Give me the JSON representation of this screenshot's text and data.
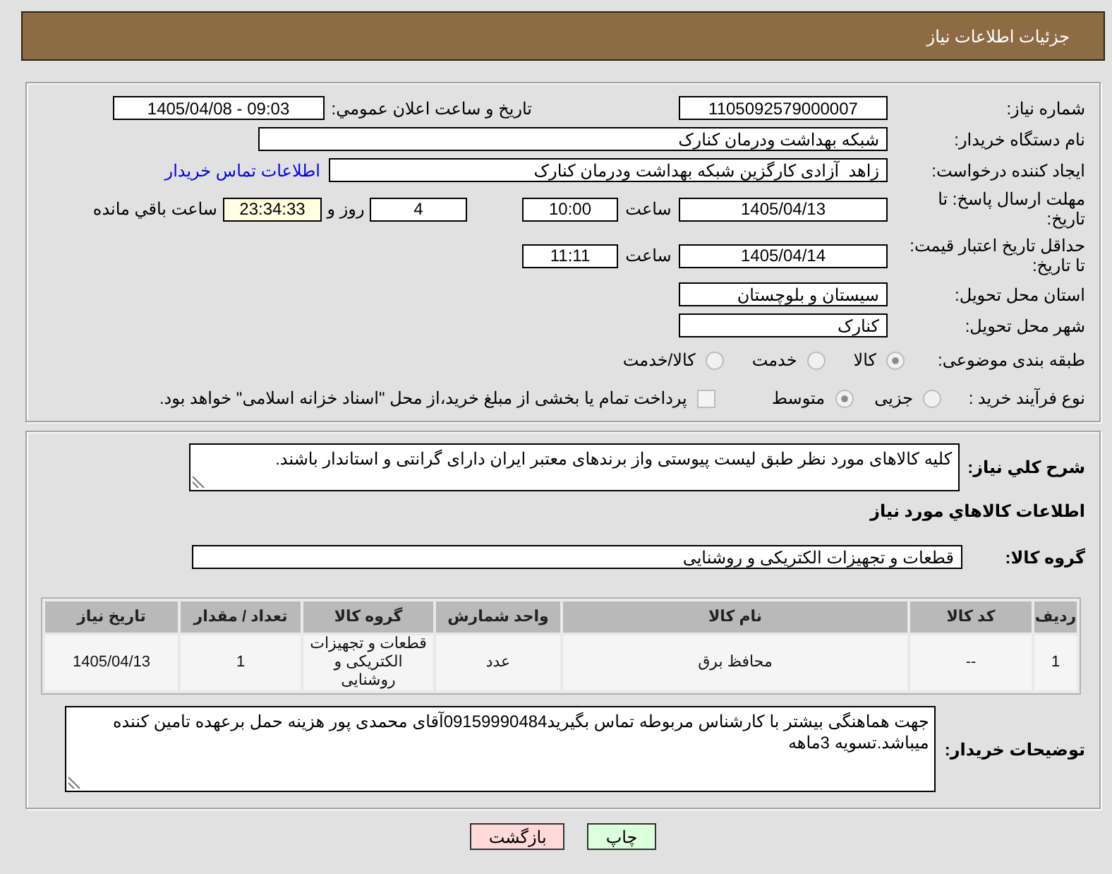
{
  "header": {
    "title": "جزئیات اطلاعات نیاز"
  },
  "details": {
    "need_number": {
      "label": "شماره نیاز:",
      "value": "1105092579000007"
    },
    "announcement": {
      "label": "تاریخ و ساعت اعلان عمومي:",
      "value": "1405/04/08 - 09:03"
    },
    "buyer_org": {
      "label": "نام دستگاه خریدار:",
      "value": "شبکه بهداشت ودرمان کنارک"
    },
    "requester": {
      "label": "ایجاد کننده درخواست:",
      "value": "زاهد  آزادی کارگزین شبکه بهداشت ودرمان کنارک",
      "contact_link": "اطلاعات تماس خریدار"
    },
    "response_deadline": {
      "label": "مهلت ارسال پاسخ: تا تاریخ:",
      "date": "1405/04/13",
      "time_label": "ساعت",
      "time": "10:00",
      "days": "4",
      "days_label": "روز و",
      "remaining": "23:34:33",
      "remaining_label": "ساعت باقي مانده"
    },
    "price_validity": {
      "label": "حداقل تاریخ اعتبار قیمت: تا تاریخ:",
      "date": "1405/04/14",
      "time_label": "ساعت",
      "time": "11:11"
    },
    "province": {
      "label": "استان محل تحویل:",
      "value": "سیستان و بلوچستان"
    },
    "city": {
      "label": "شهر محل تحویل:",
      "value": "کنارک"
    },
    "category": {
      "label": "طبقه بندی موضوعی:",
      "options": [
        {
          "label": "کالا",
          "selected": true
        },
        {
          "label": "خدمت",
          "selected": false
        },
        {
          "label": "کالا/خدمت",
          "selected": false
        }
      ]
    },
    "purchase_process": {
      "label": "نوع فرآیند خرید :",
      "options": [
        {
          "label": "جزیی",
          "selected": false
        },
        {
          "label": "متوسط",
          "selected": true
        }
      ],
      "treasury_payment": {
        "label": "پرداخت تمام یا بخشی از مبلغ خرید،از محل \"اسناد خزانه اسلامی\" خواهد بود.",
        "checked": false
      }
    }
  },
  "needs": {
    "description": {
      "label": "شرح کلي نیاز:",
      "value": "کلیه کالاهای مورد نظر طبق لیست پیوستی واز برندهای معتبر ایران دارای گرانتی و استاندار باشند."
    },
    "items_title": "اطلاعات کالاهاي مورد نیاز",
    "goods_group": {
      "label": "گروه کالا:",
      "value": "قطعات و تجهیزات الکتریکی و روشنایی"
    },
    "table": {
      "columns": [
        "ردیف",
        "کد کالا",
        "نام کالا",
        "واحد شمارش",
        "گروه کالا",
        "تعداد / مقدار",
        "تاریخ نیاز"
      ],
      "rows": [
        [
          "1",
          "--",
          "محافظ برق",
          "عدد",
          "قطعات و تجهیزات الکتریکی و روشنایی",
          "1",
          "1405/04/13"
        ]
      ]
    },
    "buyer_notes": {
      "label": "توضیحات خریدار:",
      "value": "جهت هماهنگی بیشتر با کارشناس مربوطه تماس بگیرید09159990484آقای محمدی پور هزینه حمل برعهده تامین کننده میباشد.تسویه 3ماهه"
    }
  },
  "buttons": [
    {
      "label": "چاپ",
      "kind": "print"
    },
    {
      "label": "بازگشت",
      "kind": "back"
    }
  ]
}
